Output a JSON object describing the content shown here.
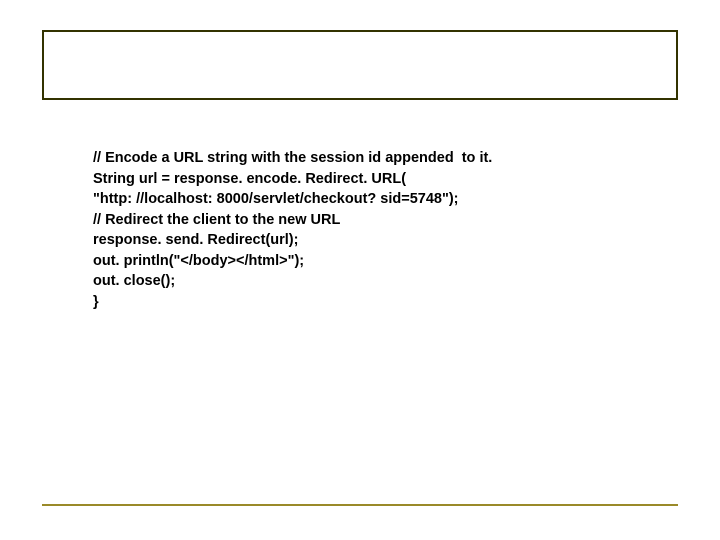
{
  "content": {
    "lines": [
      "// Encode a URL string with the session id appended  to it.",
      "String url = response. encode. Redirect. URL(",
      "\"http: //localhost: 8000/servlet/checkout? sid=5748\");",
      "// Redirect the client to the new URL",
      "response. send. Redirect(url);",
      "out. println(\"</body></html>\");",
      "out. close();",
      "}"
    ]
  }
}
